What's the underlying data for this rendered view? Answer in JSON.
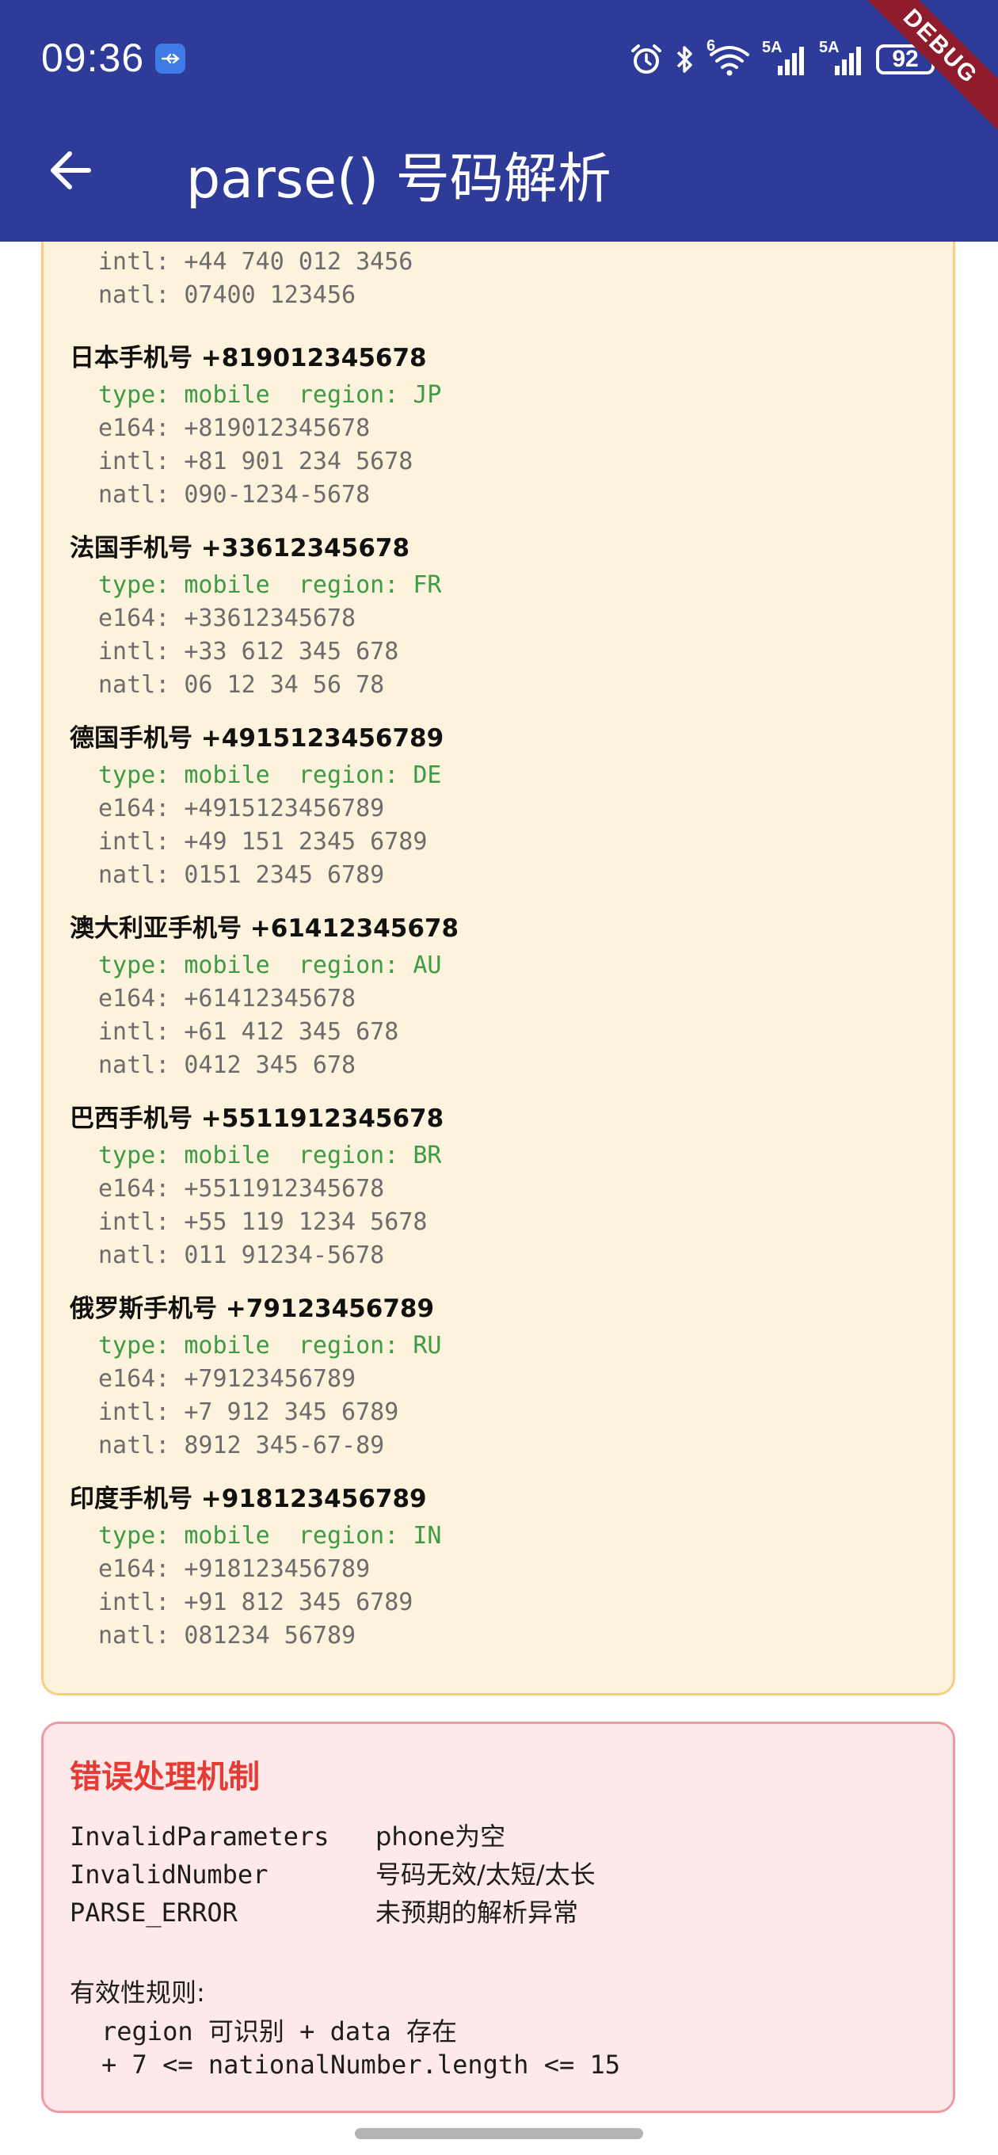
{
  "status_bar": {
    "time": "09:36",
    "battery": "92",
    "icons": [
      "usb-icon",
      "alarm-icon",
      "bluetooth-icon",
      "wifi-icon",
      "5g-signal-icon",
      "5g-signal-icon"
    ],
    "network_label_1": "5A",
    "network_label_2": "5A",
    "wifi_label": "6"
  },
  "debug_banner": "DEBUG",
  "app_bar": {
    "title": "parse() 号码解析",
    "back_icon": "arrow-left-icon"
  },
  "partial_entry": {
    "intl": "intl: +44 740 012 3456",
    "natl": "natl: 07400 123456"
  },
  "entries": [
    {
      "title": "日本手机号 +819012345678",
      "type": "type: mobile  region: JP",
      "e164": "e164: +819012345678",
      "intl": "intl: +81 901 234 5678",
      "natl": "natl: 090-1234-5678"
    },
    {
      "title": "法国手机号 +33612345678",
      "type": "type: mobile  region: FR",
      "e164": "e164: +33612345678",
      "intl": "intl: +33 612 345 678",
      "natl": "natl: 06 12 34 56 78"
    },
    {
      "title": "德国手机号 +4915123456789",
      "type": "type: mobile  region: DE",
      "e164": "e164: +4915123456789",
      "intl": "intl: +49 151 2345 6789",
      "natl": "natl: 0151 2345 6789"
    },
    {
      "title": "澳大利亚手机号 +61412345678",
      "type": "type: mobile  region: AU",
      "e164": "e164: +61412345678",
      "intl": "intl: +61 412 345 678",
      "natl": "natl: 0412 345 678"
    },
    {
      "title": "巴西手机号 +5511912345678",
      "type": "type: mobile  region: BR",
      "e164": "e164: +5511912345678",
      "intl": "intl: +55 119 1234 5678",
      "natl": "natl: 011 91234-5678"
    },
    {
      "title": "俄罗斯手机号 +79123456789",
      "type": "type: mobile  region: RU",
      "e164": "e164: +79123456789",
      "intl": "intl: +7 912 345 6789",
      "natl": "natl: 8912 345-67-89"
    },
    {
      "title": "印度手机号 +918123456789",
      "type": "type: mobile  region: IN",
      "e164": "e164: +918123456789",
      "intl": "intl: +91 812 345 6789",
      "natl": "natl: 081234 56789"
    }
  ],
  "errors": {
    "title": "错误处理机制",
    "rows": [
      {
        "key": "InvalidParameters",
        "value": "phone为空"
      },
      {
        "key": "InvalidNumber",
        "value": "号码无效/太短/太长"
      },
      {
        "key": "PARSE_ERROR",
        "value": "未预期的解析异常"
      }
    ],
    "rules_title": "有效性规则:",
    "rules": [
      "region 可识别 + data 存在",
      "+ 7 <= nationalNumber.length <= 15"
    ]
  },
  "colors": {
    "app_bar": "#2f3b98",
    "card_yellow_bg": "#fdf2dc",
    "card_yellow_border": "#f7cf83",
    "type_green": "#3e9a45",
    "error_title": "#e53b35",
    "card_red_bg": "#fde8ea",
    "card_red_border": "#ef9aa3"
  }
}
